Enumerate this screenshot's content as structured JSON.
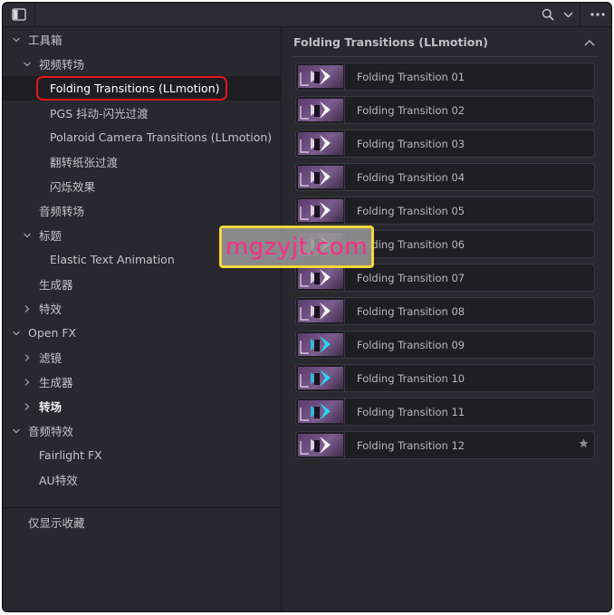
{
  "toolbar": {
    "panel_toggle_icon": "sidebar-toggle-icon",
    "search_icon": "search-icon",
    "dropdown_icon": "chevron-down-icon",
    "more_icon": "more-options-icon"
  },
  "sidebar": {
    "items": [
      {
        "label": "工具箱",
        "level": 0,
        "expanded": true
      },
      {
        "label": "视频转场",
        "level": 1,
        "expanded": true
      },
      {
        "label": "Folding Transitions (LLmotion)",
        "level": 2,
        "selected": true
      },
      {
        "label": "PGS 抖动-闪光过渡",
        "level": 2
      },
      {
        "label": "Polaroid Camera Transitions (LLmotion)",
        "level": 2
      },
      {
        "label": "翻转纸张过渡",
        "level": 2
      },
      {
        "label": "闪烁效果",
        "level": 2
      },
      {
        "label": "音频转场",
        "level": 1
      },
      {
        "label": "标题",
        "level": 1,
        "expanded": true
      },
      {
        "label": "Elastic Text Animation",
        "level": 2
      },
      {
        "label": "生成器",
        "level": 1
      },
      {
        "label": "特效",
        "level": 1,
        "expanded": false
      },
      {
        "label": "Open FX",
        "level": 0,
        "expanded": true
      },
      {
        "label": "滤镜",
        "level": 1,
        "expanded": false
      },
      {
        "label": "生成器",
        "level": 1,
        "expanded": false
      },
      {
        "label": "转场",
        "level": 1,
        "expanded": false,
        "bold": true
      },
      {
        "label": "音频特效",
        "level": 0,
        "expanded": true
      },
      {
        "label": "Fairlight FX",
        "level": 1
      },
      {
        "label": "AU特效",
        "level": 1
      }
    ],
    "favorites_label": "仅显示收藏"
  },
  "content": {
    "title": "Folding Transitions (LLmotion)",
    "items": [
      {
        "label": "Folding Transition 01",
        "accent": "#ffffff"
      },
      {
        "label": "Folding Transition 02",
        "accent": "#ffffff"
      },
      {
        "label": "Folding Transition 03",
        "accent": "#ffffff"
      },
      {
        "label": "Folding Transition 04",
        "accent": "#ffffff"
      },
      {
        "label": "Folding Transition 05",
        "accent": "#ffffff"
      },
      {
        "label": "Folding Transition 06",
        "accent": "#ffffff"
      },
      {
        "label": "Folding Transition 07",
        "accent": "#ffffff"
      },
      {
        "label": "Folding Transition 08",
        "accent": "#ffffff"
      },
      {
        "label": "Folding Transition 09",
        "accent": "#22d8f0"
      },
      {
        "label": "Folding Transition 10",
        "accent": "#22d8f0"
      },
      {
        "label": "Folding Transition 11",
        "accent": "#22d8f0"
      },
      {
        "label": "Folding Transition 12",
        "accent": "#ffffff",
        "star": true
      }
    ]
  },
  "watermark": {
    "text": "mgzyjt.com"
  },
  "colors": {
    "highlight_outline": "#e4141e",
    "watermark_border": "#f3d73a",
    "watermark_text": "#ff2b8a",
    "panel_bg": "#28282e"
  }
}
